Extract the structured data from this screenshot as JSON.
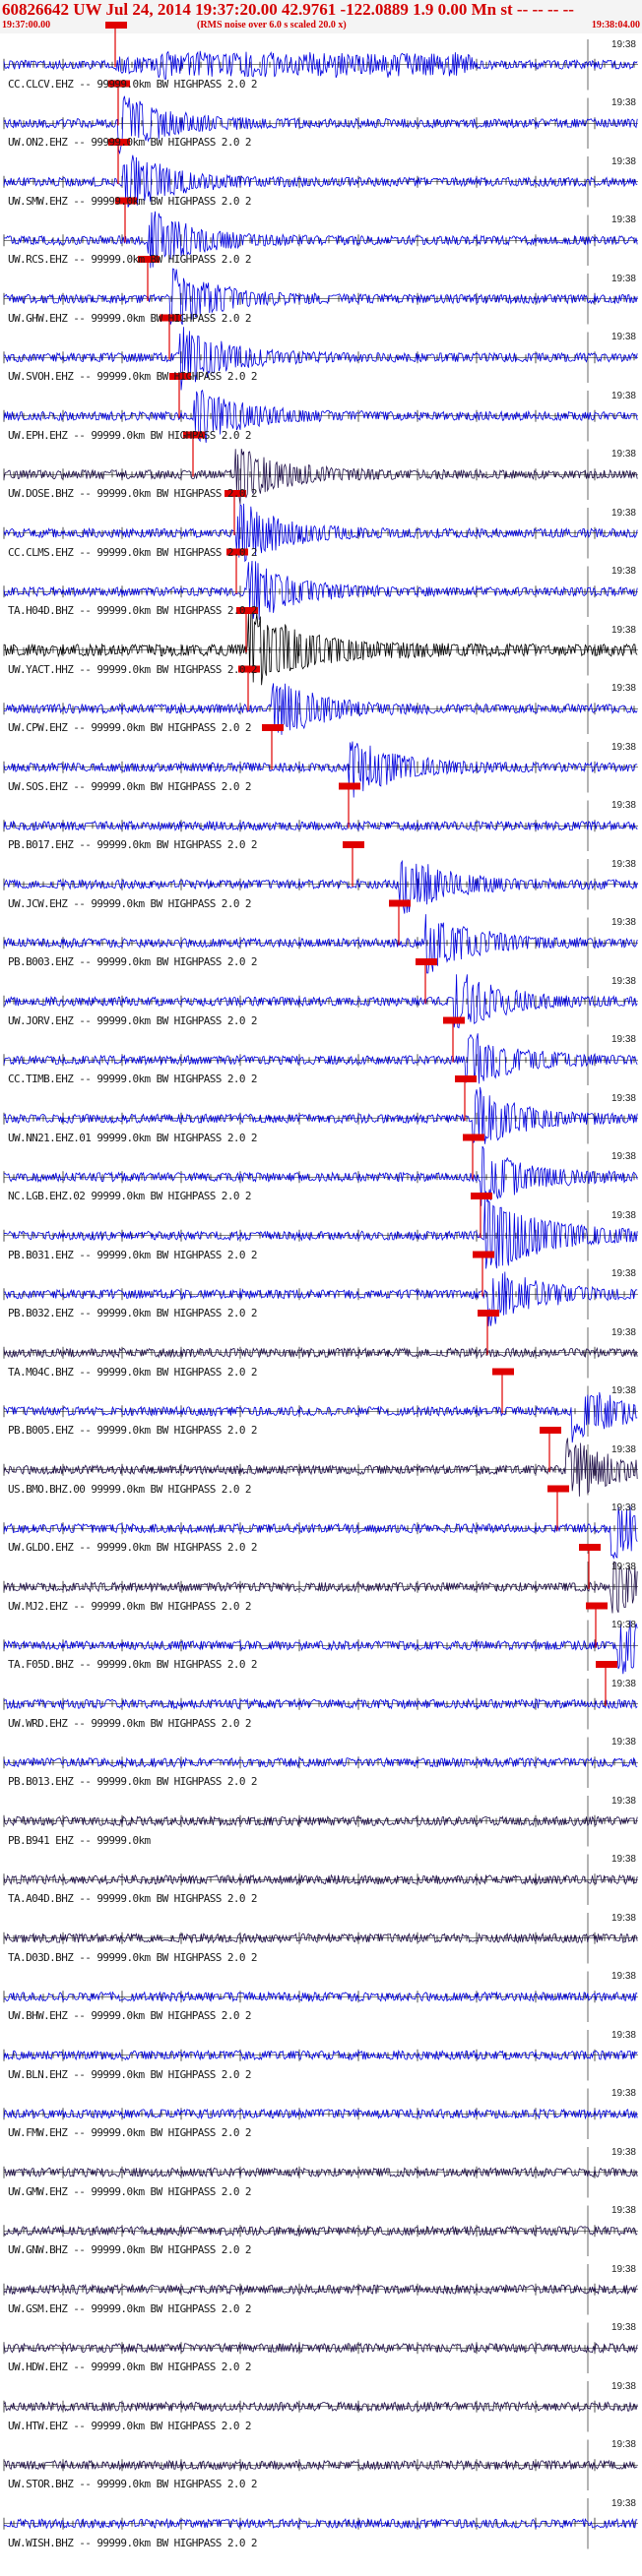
{
  "header": {
    "title": "60826642 UW Jul 24, 2014 19:37:20.00   42.9761 -122.0889  1.9 0.00 Mn st -- -- -- --",
    "start_time": "19:37:00.00",
    "noise_note": "(RMS noise over 6.0 s scaled 20.0 x)",
    "end_time": "19:38:04.00"
  },
  "colors": {
    "background": "#ffffff",
    "title": "#d40000",
    "pick_marker": "#e00000",
    "trace_blue": "#0000e0",
    "trace_dark": "#20104a",
    "trace_black": "#000000"
  },
  "chart_data": {
    "type": "seismogram",
    "time_window": [
      "19:37:00.00",
      "19:38:04.00"
    ],
    "minute_label": "19:38",
    "traces": [
      {
        "label": "CC.CLCV.EHZ -- 99999.0km BW HIGHPASS 2.0 2",
        "pick": "CC.CLCV"
      },
      {
        "label": "UW.ON2.EHZ -- 99999.0km BW HIGHPASS 2.0 2",
        "pick": "UW.ON2"
      },
      {
        "label": "UW.SMW.EHZ -- 99999.0km BW HIGHPASS 2.0 2",
        "pick": "UW.SMW"
      },
      {
        "label": "UW.RCS.EHZ -- 99999.0km BW HIGHPASS 2.0 2",
        "pick": "UW.RCS"
      },
      {
        "label": "UW.GHW.EHZ -- 99999.0km BW HIGHPASS 2.0 2",
        "pick": "UW.GHW"
      },
      {
        "label": "UW.SVOH.EHZ -- 99999.0km BW HIGHPASS 2.0 2",
        "pick": "UW.SVOH"
      },
      {
        "label": "UW.EPH.EHZ -- 99999.0km BW HIGHPASS 2.0 2",
        "pick": "UW.EPH"
      },
      {
        "label": "UW.DOSE.BHZ -- 99999.0km BW HIGHPASS 2.0 2",
        "pick": "UW.DOSE"
      },
      {
        "label": "CC.CLMS.EHZ -- 99999.0km BW HIGHPASS 2.0 2",
        "pick": "CC.CLMS"
      },
      {
        "label": "TA.H04D.BHZ -- 99999.0km BW HIGHPASS 2.0 2",
        "pick": "TA.H04D"
      },
      {
        "label": "UW.YACT.HHZ -- 99999.0km BW HIGHPASS 2.0 2",
        "pick": "UW.YACT"
      },
      {
        "label": "UW.CPW.EHZ -- 99999.0km BW HIGHPASS 2.0 2",
        "pick": "UW.CPW"
      },
      {
        "label": "UW.SOS.EHZ -- 99999.0km BW HIGHPASS 2.0 2",
        "pick": "UW.SOS"
      },
      {
        "label": "PB.B017.EHZ -- 99999.0km BW HIGHPASS 2.0 2",
        "pick": "PB.B017"
      },
      {
        "label": "UW.JCW.EHZ -- 99999.0km BW HIGHPASS 2.0 2",
        "pick": "UW.JCW"
      },
      {
        "label": "PB.B003.EHZ -- 99999.0km BW HIGHPASS 2.0 2",
        "pick": "PB.B003"
      },
      {
        "label": "UW.JORV.EHZ -- 99999.0km BW HIGHPASS 2.0 2",
        "pick": "UW.JORV"
      },
      {
        "label": "CC.TIMB.EHZ -- 99999.0km BW HIGHPASS 2.0 2",
        "pick": "CC.TIMB"
      },
      {
        "label": "UW.NN21.EHZ.01 99999.0km BW HIGHPASS 2.0 2",
        "pick": "UW.NN21"
      },
      {
        "label": "NC.LGB.EHZ.02 99999.0km BW HIGHPASS 2.0 2",
        "pick": "NC.LGB"
      },
      {
        "label": "PB.B031.EHZ -- 99999.0km BW HIGHPASS 2.0 2",
        "pick": "PB.B031"
      },
      {
        "label": "PB.B032.EHZ -- 99999.0km BW HIGHPASS 2.0 2",
        "pick": "PB.B032"
      },
      {
        "label": "TA.M04C.BHZ -- 99999.0km BW HIGHPASS 2.0 2",
        "pick": "TA.M04C"
      },
      {
        "label": "PB.B005.EHZ -- 99999.0km BW HIGHPASS 2.0 2",
        "pick": "PB.B005"
      },
      {
        "label": "US.BMO.BHZ.00 99999.0km BW HIGHPASS 2.0 2",
        "pick": "US.BMO"
      },
      {
        "label": "UW.GLDO.EHZ -- 99999.0km BW HIGHPASS 2.0 2",
        "pick": "UW.GLDO"
      },
      {
        "label": "UW.MJ2.EHZ -- 99999.0km BW HIGHPASS 2.0 2",
        "pick": "UW.MJ2"
      },
      {
        "label": "TA.F05D.BHZ -- 99999.0km BW HIGHPASS 2.0 2",
        "pick": "TA.F05D"
      },
      {
        "label": "UW.WRD.EHZ -- 99999.0km BW HIGHPASS 2.0 2",
        "pick": "UW.WRD"
      },
      {
        "label": "PB.B013.EHZ -- 99999.0km BW HIGHPASS 2.0 2",
        "pick": ""
      },
      {
        "label": "PB.B941 EHZ -- 99999.0km",
        "pick": ""
      },
      {
        "label": "TA.A04D.BHZ -- 99999.0km BW HIGHPASS 2.0 2",
        "pick": ""
      },
      {
        "label": "TA.D03D.BHZ -- 99999.0km BW HIGHPASS 2.0 2",
        "pick": ""
      },
      {
        "label": "UW.BHW.EHZ -- 99999.0km BW HIGHPASS 2.0 2",
        "pick": ""
      },
      {
        "label": "UW.BLN.EHZ -- 99999.0km BW HIGHPASS 2.0 2",
        "pick": ""
      },
      {
        "label": "UW.FMW.EHZ -- 99999.0km BW HIGHPASS 2.0 2",
        "pick": ""
      },
      {
        "label": "UW.GMW.EHZ -- 99999.0km BW HIGHPASS 2.0 2",
        "pick": ""
      },
      {
        "label": "UW.GNW.BHZ -- 99999.0km BW HIGHPASS 2.0 2",
        "pick": ""
      },
      {
        "label": "UW.GSM.EHZ -- 99999.0km BW HIGHPASS 2.0 2",
        "pick": ""
      },
      {
        "label": "UW.HDW.EHZ -- 99999.0km BW HIGHPASS 2.0 2",
        "pick": ""
      },
      {
        "label": "UW.HTW.EHZ -- 99999.0km BW HIGHPASS 2.0 2",
        "pick": ""
      },
      {
        "label": "UW.STOR.BHZ -- 99999.0km BW HIGHPASS 2.0 2",
        "pick": ""
      },
      {
        "label": "UW.WISH.BHZ -- 99999.0km BW HIGHPASS 2.0 2",
        "pick": ""
      }
    ]
  }
}
